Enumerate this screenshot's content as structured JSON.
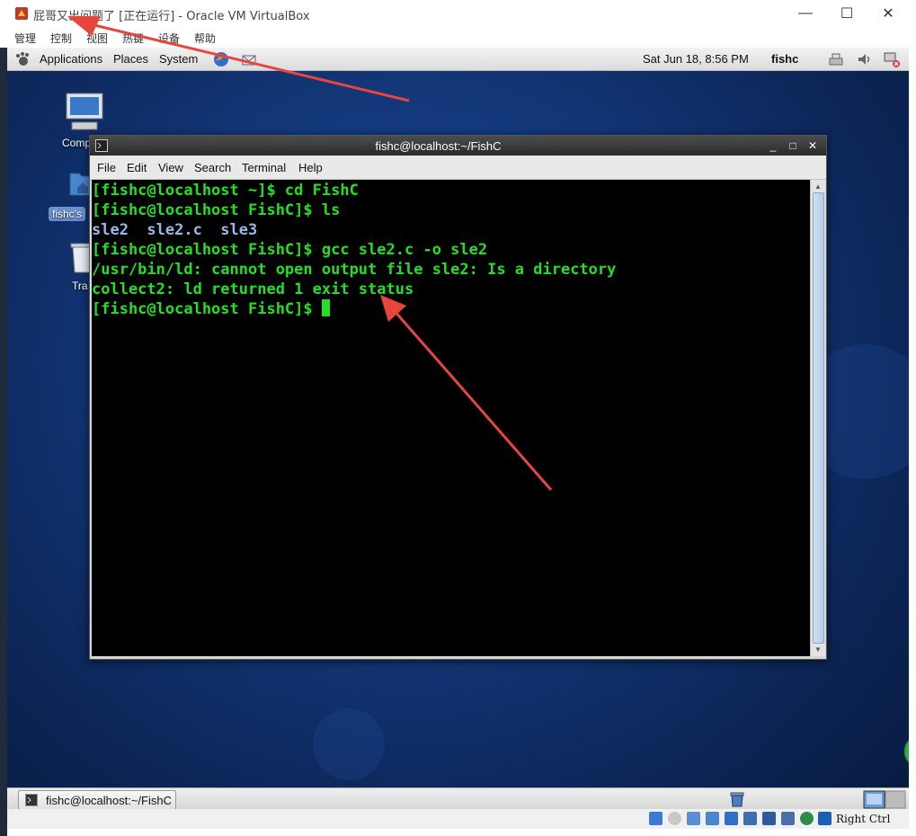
{
  "host_window": {
    "title": "屁哥又出问题了 [正在运行] - Oracle VM VirtualBox",
    "menu": [
      "管理",
      "控制",
      "视图",
      "热键",
      "设备",
      "帮助"
    ],
    "buttons": {
      "minimize": "—",
      "maximize": "☐",
      "close": "✕"
    }
  },
  "guest": {
    "top_panel": {
      "menus": [
        "Applications",
        "Places",
        "System"
      ],
      "datetime": "Sat Jun 18,  8:56 PM",
      "username": "fishc"
    },
    "desktop_icons": [
      {
        "label": "Comp",
        "icon": "computer-icon"
      },
      {
        "label": "fishc's",
        "icon": "home-folder-icon"
      },
      {
        "label": "Tra",
        "icon": "trash-icon"
      }
    ],
    "terminal": {
      "title": "fishc@localhost:~/FishC",
      "menu": [
        "File",
        "Edit",
        "View",
        "Search",
        "Terminal",
        "Help"
      ],
      "lines": [
        {
          "text": "[fishc@localhost ~]$ cd FishC",
          "kind": "prompt"
        },
        {
          "text": "[fishc@localhost FishC]$ ls",
          "kind": "prompt"
        },
        {
          "text": "sle2  sle2.c  sle3",
          "kind": "ls"
        },
        {
          "text": "[fishc@localhost FishC]$ gcc sle2.c -o sle2",
          "kind": "prompt"
        },
        {
          "text": "/usr/bin/ld: cannot open output file sle2: Is a directory",
          "kind": "output"
        },
        {
          "text": "collect2: ld returned 1 exit status",
          "kind": "output"
        },
        {
          "text": "[fishc@localhost FishC]$ ",
          "kind": "prompt"
        }
      ],
      "text_color": "#22e022",
      "ls_color": "#9ab8e6"
    },
    "bottom_panel": {
      "task_label": "fishc@localhost:~/FishC"
    }
  },
  "vbox_status": {
    "host_key_label": "Right Ctrl"
  },
  "annotations": {
    "arrow_color": "#e8453c"
  }
}
